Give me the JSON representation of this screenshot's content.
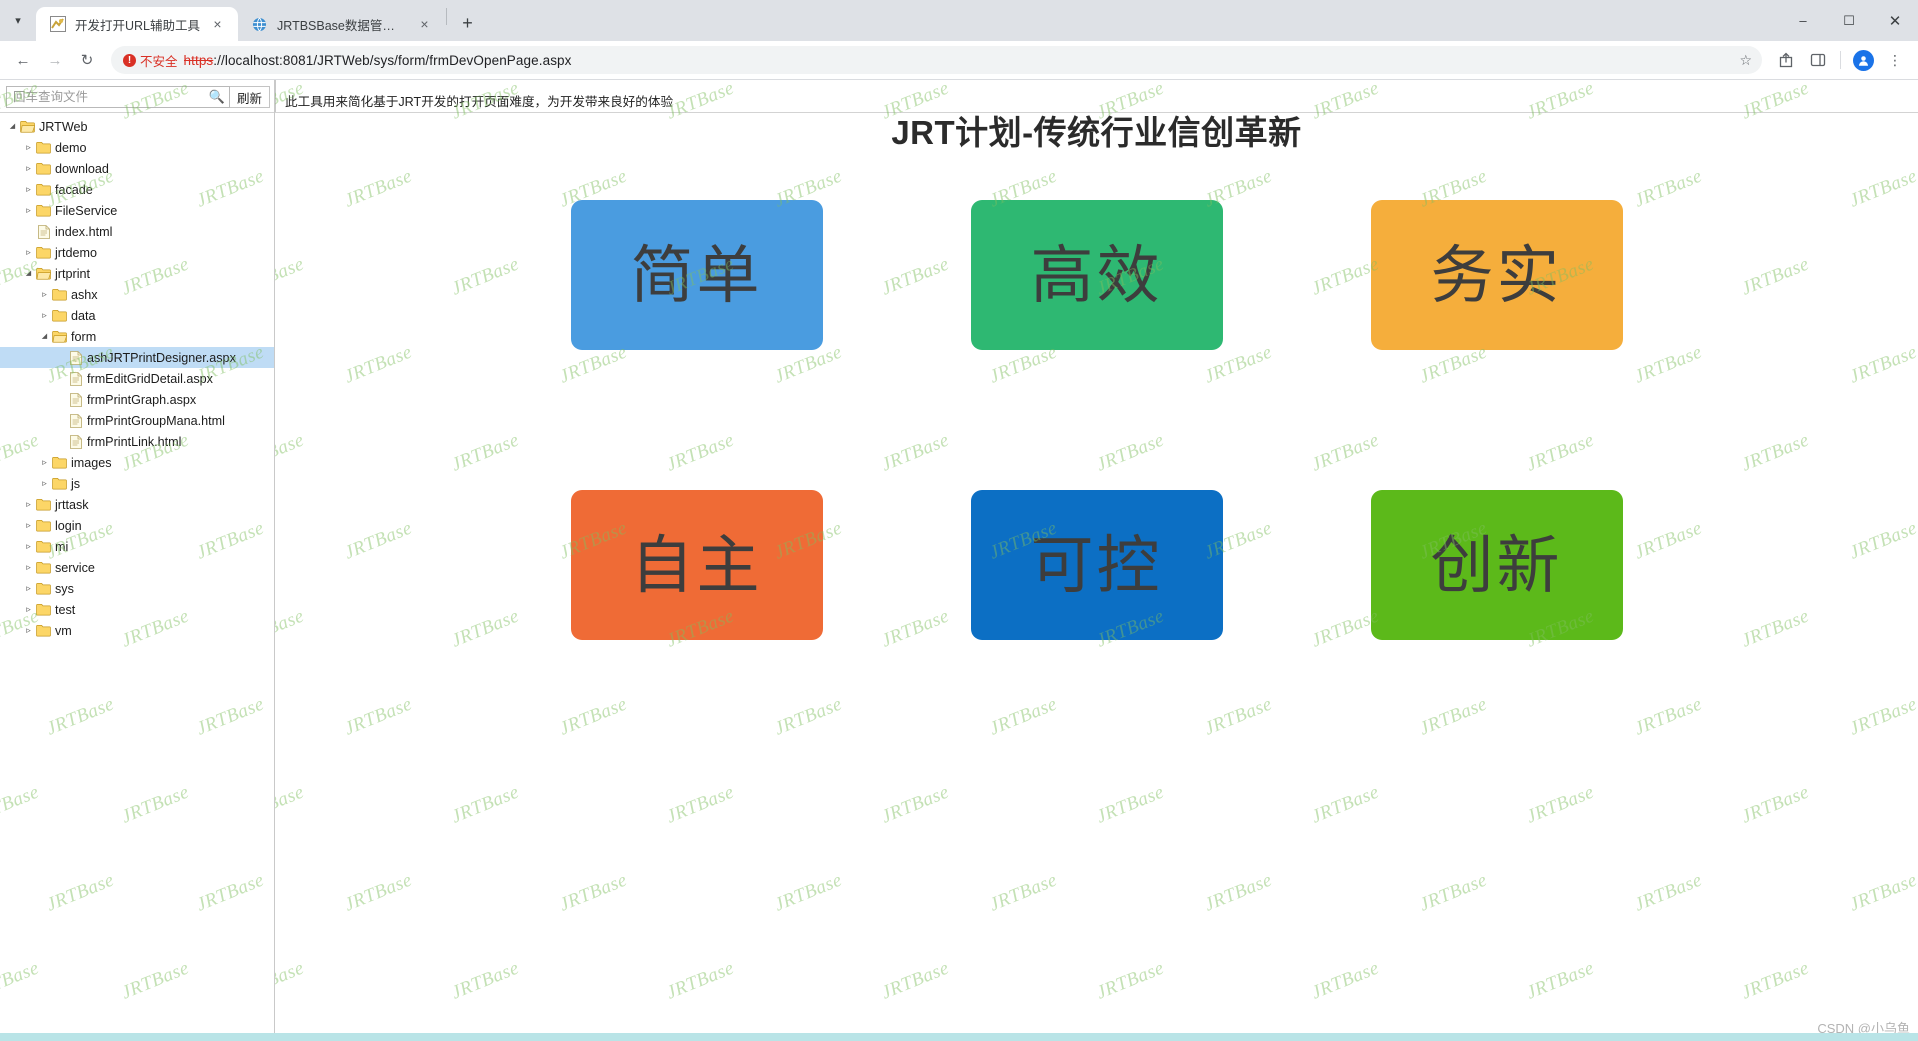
{
  "browser": {
    "tab_list_icon": "chevron-down-icon",
    "tabs": [
      {
        "title": "开发打开URL辅助工具",
        "favicon": "app-icon",
        "active": true,
        "close_label": "×"
      },
      {
        "title": "JRTBSBase数据管理工具",
        "favicon": "globe-icon",
        "active": false,
        "close_label": "×"
      }
    ],
    "new_tab_label": "+",
    "window_controls": {
      "minimize": "–",
      "maximize": "☐",
      "close": "✕"
    },
    "nav": {
      "back": "←",
      "forward": "→",
      "reload": "↻"
    },
    "omnibox": {
      "security_badge_icon": "not-secure-icon",
      "security_badge_glyph": "!",
      "security_text": "不安全",
      "url_scheme": "https",
      "url_rest": "://localhost:8081/JRTWeb/sys/form/frmDevOpenPage.aspx",
      "star_icon": "bookmark-star-icon"
    },
    "toolbar_icons": [
      {
        "name": "share-icon",
        "glyph": "⎙"
      },
      {
        "name": "sidepanel-icon",
        "glyph": "◫"
      },
      {
        "name": "profile-avatar-icon",
        "glyph": "●"
      },
      {
        "name": "chrome-menu-icon",
        "glyph": "⋮"
      }
    ]
  },
  "left_pane": {
    "search": {
      "placeholder": "回车查询文件",
      "value": "",
      "icon": "search-icon"
    },
    "refresh_button": "刷新",
    "tree": [
      {
        "label": "JRTWeb",
        "type": "folder-open",
        "depth": 0,
        "arrow": "open",
        "selected": false
      },
      {
        "label": "demo",
        "type": "folder",
        "depth": 1,
        "arrow": "closed",
        "selected": false
      },
      {
        "label": "download",
        "type": "folder",
        "depth": 1,
        "arrow": "closed",
        "selected": false
      },
      {
        "label": "facade",
        "type": "folder",
        "depth": 1,
        "arrow": "closed",
        "selected": false
      },
      {
        "label": "FileService",
        "type": "folder",
        "depth": 1,
        "arrow": "closed",
        "selected": false
      },
      {
        "label": "index.html",
        "type": "file",
        "depth": 1,
        "arrow": "none",
        "selected": false
      },
      {
        "label": "jrtdemo",
        "type": "folder",
        "depth": 1,
        "arrow": "closed",
        "selected": false
      },
      {
        "label": "jrtprint",
        "type": "folder-open",
        "depth": 1,
        "arrow": "open",
        "selected": false
      },
      {
        "label": "ashx",
        "type": "folder",
        "depth": 2,
        "arrow": "closed",
        "selected": false
      },
      {
        "label": "data",
        "type": "folder",
        "depth": 2,
        "arrow": "closed",
        "selected": false
      },
      {
        "label": "form",
        "type": "folder-open",
        "depth": 2,
        "arrow": "open",
        "selected": false
      },
      {
        "label": "ashJRTPrintDesigner.aspx",
        "type": "file",
        "depth": 3,
        "arrow": "none",
        "selected": true
      },
      {
        "label": "frmEditGridDetail.aspx",
        "type": "file",
        "depth": 3,
        "arrow": "none",
        "selected": false
      },
      {
        "label": "frmPrintGraph.aspx",
        "type": "file",
        "depth": 3,
        "arrow": "none",
        "selected": false
      },
      {
        "label": "frmPrintGroupMana.html",
        "type": "file",
        "depth": 3,
        "arrow": "none",
        "selected": false
      },
      {
        "label": "frmPrintLink.html",
        "type": "file",
        "depth": 3,
        "arrow": "none",
        "selected": false
      },
      {
        "label": "images",
        "type": "folder",
        "depth": 2,
        "arrow": "closed",
        "selected": false
      },
      {
        "label": "js",
        "type": "folder",
        "depth": 2,
        "arrow": "closed",
        "selected": false
      },
      {
        "label": "jrttask",
        "type": "folder",
        "depth": 1,
        "arrow": "closed",
        "selected": false
      },
      {
        "label": "login",
        "type": "folder",
        "depth": 1,
        "arrow": "closed",
        "selected": false
      },
      {
        "label": "mi",
        "type": "folder",
        "depth": 1,
        "arrow": "closed",
        "selected": false
      },
      {
        "label": "service",
        "type": "folder",
        "depth": 1,
        "arrow": "closed",
        "selected": false
      },
      {
        "label": "sys",
        "type": "folder",
        "depth": 1,
        "arrow": "closed",
        "selected": false
      },
      {
        "label": "test",
        "type": "folder",
        "depth": 1,
        "arrow": "closed",
        "selected": false
      },
      {
        "label": "vm",
        "type": "folder",
        "depth": 1,
        "arrow": "closed",
        "selected": false
      }
    ]
  },
  "page_header": {
    "hint_text": "此工具用来简化基于JRT开发的打开页面难度，为开发带来良好的体验"
  },
  "main": {
    "title": "JRT计划-传统行业信创革新",
    "tiles": [
      {
        "label": "简单",
        "color": "#4a9ce0",
        "text_color": "#3d3d3d"
      },
      {
        "label": "高效",
        "color": "#2eb872",
        "text_color": "#3d3d3d"
      },
      {
        "label": "务实",
        "color": "#f5ae3c",
        "text_color": "#3d3d3d"
      },
      {
        "label": "自主",
        "color": "#ef6b36",
        "text_color": "#3d3d3d"
      },
      {
        "label": "可控",
        "color": "#0c6fc4",
        "text_color": "#3d3d3d"
      },
      {
        "label": "创新",
        "color": "#5cb91a",
        "text_color": "#3d3d3d"
      }
    ]
  },
  "watermark": {
    "text": "JRTBase",
    "color": "#7fbf5f",
    "csdn": "CSDN @小乌鱼"
  }
}
